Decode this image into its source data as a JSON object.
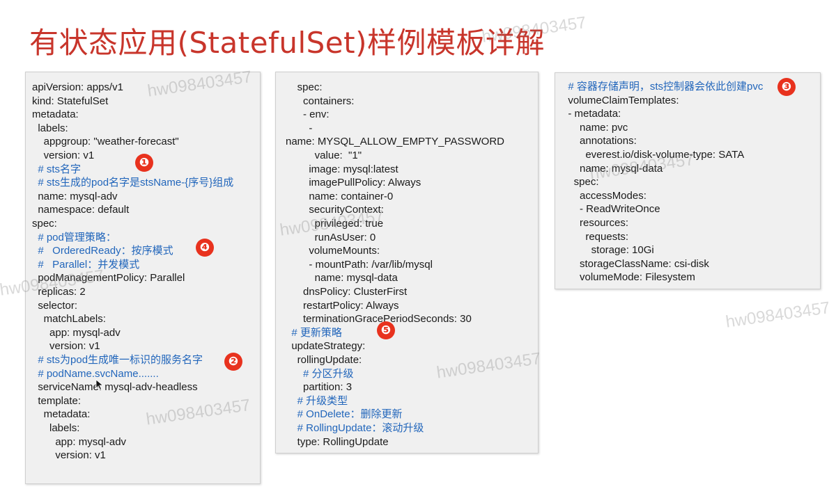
{
  "title": "有状态应用(StatefulSet)样例模板详解",
  "panels": {
    "left": [
      {
        "text": "apiVersion: apps/v1",
        "comment": false
      },
      {
        "text": "kind: StatefulSet",
        "comment": false
      },
      {
        "text": "metadata:",
        "comment": false
      },
      {
        "text": "  labels:",
        "comment": false
      },
      {
        "text": "    appgroup: \"weather-forecast\"",
        "comment": false
      },
      {
        "text": "    version: v1",
        "comment": false
      },
      {
        "text": "  # sts名字",
        "comment": true
      },
      {
        "text": "  # sts生成的pod名字是stsName-{序号}组成",
        "comment": true
      },
      {
        "text": "  name: mysql-adv",
        "comment": false
      },
      {
        "text": "  namespace: default",
        "comment": false
      },
      {
        "text": "spec:",
        "comment": false
      },
      {
        "text": "  # pod管理策略：",
        "comment": true
      },
      {
        "text": "  #   OrderedReady：按序模式",
        "comment": true
      },
      {
        "text": "  #   Parallel：并发模式",
        "comment": true
      },
      {
        "text": "  podManagementPolicy: Parallel",
        "comment": false
      },
      {
        "text": "  replicas: 2",
        "comment": false
      },
      {
        "text": "  selector:",
        "comment": false
      },
      {
        "text": "    matchLabels:",
        "comment": false
      },
      {
        "text": "      app: mysql-adv",
        "comment": false
      },
      {
        "text": "      version: v1",
        "comment": false
      },
      {
        "text": "  # sts为pod生成唯一标识的服务名字",
        "comment": true
      },
      {
        "text": "  # podName.svcName.......",
        "comment": true
      },
      {
        "text": "  serviceName: mysql-adv-headless",
        "comment": false
      },
      {
        "text": "  template:",
        "comment": false
      },
      {
        "text": "    metadata:",
        "comment": false
      },
      {
        "text": "      labels:",
        "comment": false
      },
      {
        "text": "        app: mysql-adv",
        "comment": false
      },
      {
        "text": "        version: v1",
        "comment": false
      }
    ],
    "middle": [
      {
        "text": "    spec:",
        "comment": false
      },
      {
        "text": "      containers:",
        "comment": false
      },
      {
        "text": "      - env:",
        "comment": false
      },
      {
        "text": "        -",
        "comment": false
      },
      {
        "text": "name: MYSQL_ALLOW_EMPTY_PASSWORD",
        "comment": false
      },
      {
        "text": "          value:  \"1\"",
        "comment": false
      },
      {
        "text": "        image: mysql:latest",
        "comment": false
      },
      {
        "text": "        imagePullPolicy: Always",
        "comment": false
      },
      {
        "text": "        name: container-0",
        "comment": false
      },
      {
        "text": "        securityContext:",
        "comment": false
      },
      {
        "text": "          privileged: true",
        "comment": false
      },
      {
        "text": "          runAsUser: 0",
        "comment": false
      },
      {
        "text": "        volumeMounts:",
        "comment": false
      },
      {
        "text": "        - mountPath: /var/lib/mysql",
        "comment": false
      },
      {
        "text": "          name: mysql-data",
        "comment": false
      },
      {
        "text": "      dnsPolicy: ClusterFirst",
        "comment": false
      },
      {
        "text": "      restartPolicy: Always",
        "comment": false
      },
      {
        "text": "      terminationGracePeriodSeconds: 30",
        "comment": false
      },
      {
        "text": "  # 更新策略",
        "comment": true
      },
      {
        "text": "  updateStrategy:",
        "comment": false
      },
      {
        "text": "    rollingUpdate:",
        "comment": false
      },
      {
        "text": "      # 分区升级",
        "comment": true
      },
      {
        "text": "      partition: 3",
        "comment": false
      },
      {
        "text": "    # 升级类型",
        "comment": true
      },
      {
        "text": "    # OnDelete：删除更新",
        "comment": true
      },
      {
        "text": "    # RollingUpdate：滚动升级",
        "comment": true
      },
      {
        "text": "    type: RollingUpdate",
        "comment": false
      }
    ],
    "right": [
      {
        "text": "  # 容器存储声明，sts控制器会依此创建pvc",
        "comment": true
      },
      {
        "text": "  volumeClaimTemplates:",
        "comment": false
      },
      {
        "text": "  - metadata:",
        "comment": false
      },
      {
        "text": "      name: pvc",
        "comment": false
      },
      {
        "text": "      annotations:",
        "comment": false
      },
      {
        "text": "        everest.io/disk-volume-type: SATA",
        "comment": false
      },
      {
        "text": "      name: mysql-data",
        "comment": false
      },
      {
        "text": "    spec:",
        "comment": false
      },
      {
        "text": "      accessModes:",
        "comment": false
      },
      {
        "text": "      - ReadWriteOnce",
        "comment": false
      },
      {
        "text": "      resources:",
        "comment": false
      },
      {
        "text": "        requests:",
        "comment": false
      },
      {
        "text": "          storage: 10Gi",
        "comment": false
      },
      {
        "text": "      storageClassName: csi-disk",
        "comment": false
      },
      {
        "text": "      volumeMode: Filesystem",
        "comment": false
      }
    ]
  },
  "badges": {
    "b1": "❶",
    "b2": "❷",
    "b3": "❸",
    "b4": "❹",
    "b5": "❺"
  },
  "watermark": "hw098403457",
  "colors": {
    "title": "#c8352b",
    "comment": "#2266bb",
    "badge": "#e8321e",
    "panel_bg": "#f0f0f0"
  }
}
